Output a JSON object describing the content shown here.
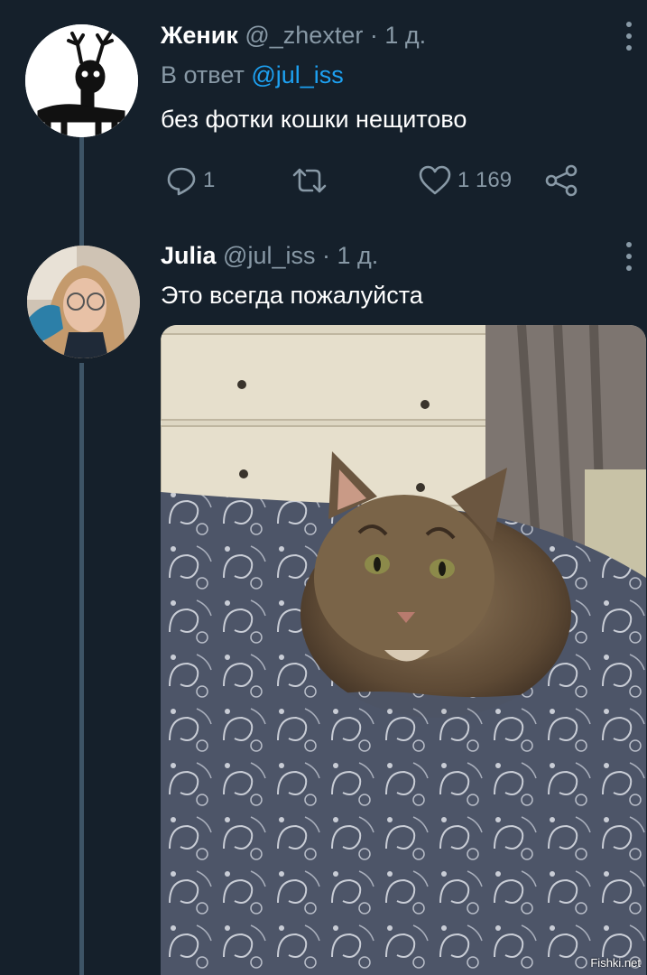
{
  "tweets": [
    {
      "name": "Женик",
      "handle": "@_zhexter",
      "separator": "·",
      "time": "1 д.",
      "reply_prefix": "В ответ",
      "reply_to": "@jul_iss",
      "text": "без фотки кошки нещитово",
      "actions": {
        "replies": "1",
        "likes": "1 169"
      }
    },
    {
      "name": "Julia",
      "handle": "@jul_iss",
      "separator": "·",
      "time": "1 д.",
      "text": "Это всегда пожалуйста"
    }
  ],
  "watermark": "Fishki.net",
  "colors": {
    "background": "#15202b",
    "muted": "#8899a6",
    "mention": "#1da1f2",
    "thread_line": "#3d5466"
  },
  "icons": [
    "reply-icon",
    "retweet-icon",
    "like-icon",
    "share-icon",
    "more-icon"
  ]
}
